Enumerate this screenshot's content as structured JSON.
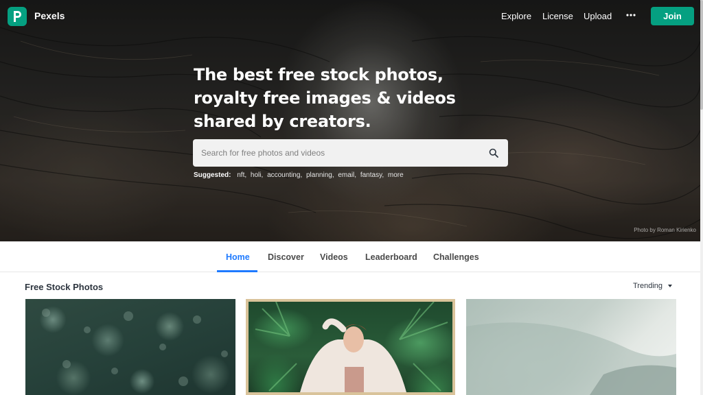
{
  "brand": {
    "name": "Pexels",
    "logo_letter": "P",
    "accent_color": "#05a081"
  },
  "nav": {
    "links": [
      "Explore",
      "License",
      "Upload"
    ],
    "more_icon": "ellipsis-icon",
    "join_label": "Join"
  },
  "hero": {
    "title": "The best free stock photos, royalty free images & videos shared by creators.",
    "search_placeholder": "Search for free photos and videos",
    "search_icon": "search-icon",
    "suggested_label": "Suggested:",
    "suggested_terms": [
      "nft",
      "holi",
      "accounting",
      "planning",
      "email",
      "fantasy",
      "more"
    ],
    "photo_credit": "Photo by Roman Kirienko"
  },
  "tabs": {
    "items": [
      "Home",
      "Discover",
      "Videos",
      "Leaderboard",
      "Challenges"
    ],
    "active": "Home",
    "active_color": "#1e7aff"
  },
  "section": {
    "title": "Free Stock Photos",
    "sort_label": "Trending"
  }
}
